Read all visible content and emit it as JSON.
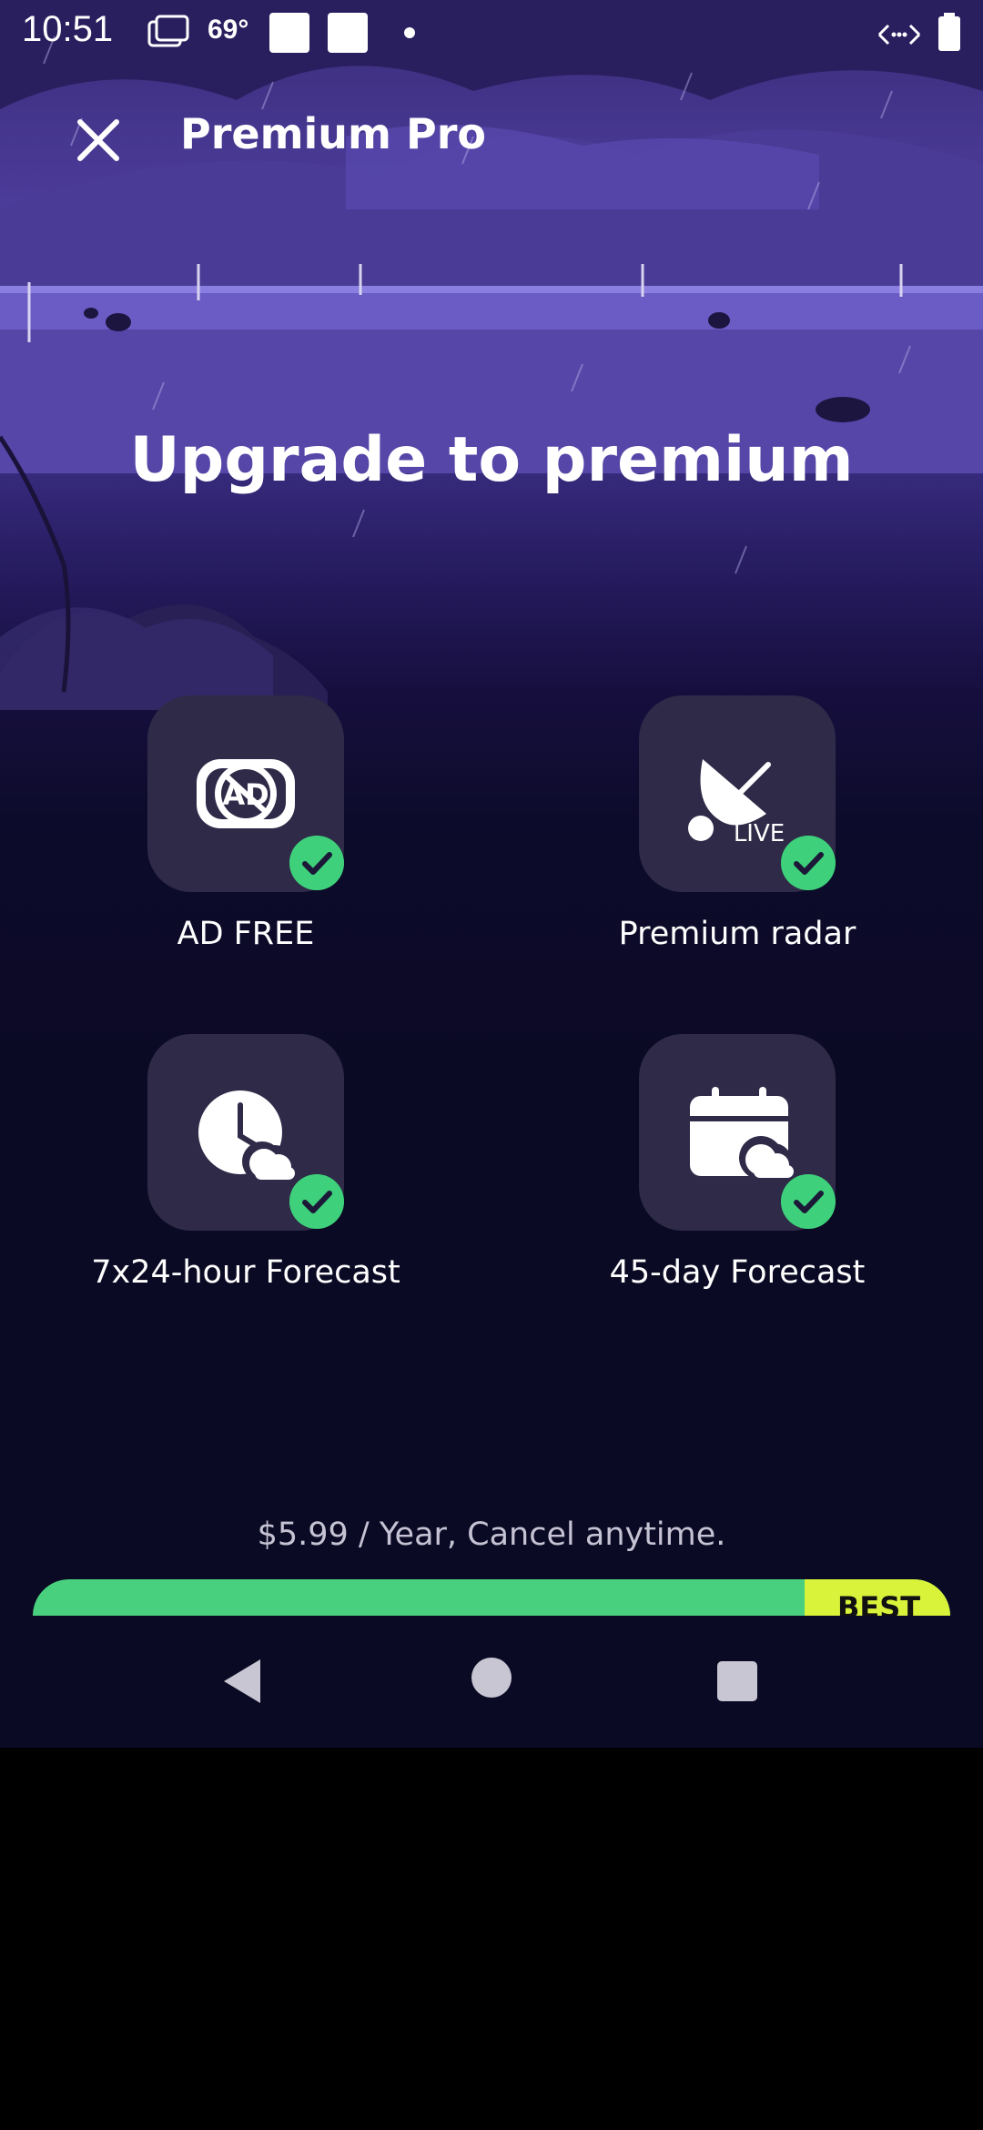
{
  "status_bar": {
    "time": "10:51",
    "temperature": "69°",
    "icons": [
      "photos-icon",
      "square-notification-icon",
      "square-notification-icon",
      "dot-icon",
      "network-icon",
      "battery-icon"
    ]
  },
  "header": {
    "title": "Premium Pro",
    "close_icon": "close-icon"
  },
  "headline": "Upgrade to premium",
  "features": [
    {
      "label": "AD FREE",
      "icon": "no-ads-icon",
      "included": true
    },
    {
      "label": "Premium radar",
      "icon": "live-radar-dish-icon",
      "badge": "LIVE",
      "included": true
    },
    {
      "label": "7x24-hour Forecast",
      "icon": "clock-cloud-icon",
      "included": true
    },
    {
      "label": "45-day Forecast",
      "icon": "calendar-cloud-icon",
      "included": true
    }
  ],
  "pricing": {
    "text": "$5.99 / Year, Cancel anytime."
  },
  "cta": {
    "badge": "BEST"
  },
  "nav": [
    "back-icon",
    "home-icon",
    "recents-icon"
  ],
  "colors": {
    "accent_green": "#48d07e",
    "badge_yellow": "#d9f23a",
    "tile_bg": "#2e2a48",
    "background": "#0b0a24"
  }
}
